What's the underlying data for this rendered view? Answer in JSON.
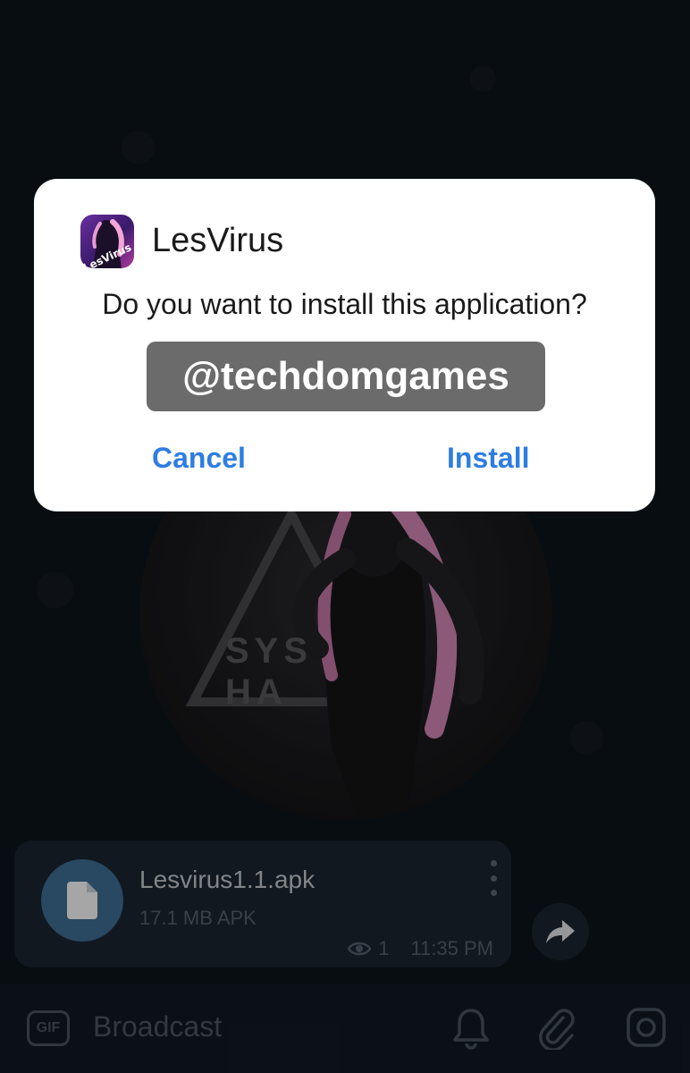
{
  "dialog": {
    "app_name": "LesVirus",
    "icon_text": "LesVirus",
    "question": "Do you want to install this application?",
    "watermark": "@techdomgames",
    "cancel_label": "Cancel",
    "install_label": "Install"
  },
  "message": {
    "poster_line1": "SYS",
    "poster_line2": "HA",
    "file_name": "Lesvirus1.1.apk",
    "file_size": "17.1 MB APK",
    "views": "1",
    "time": "11:35 PM"
  },
  "bottom_bar": {
    "gif_label": "GIF",
    "broadcast_label": "Broadcast"
  },
  "colors": {
    "accent": "#2f7de1",
    "file_icon_bg": "#3f6f97",
    "background": "#0c141b"
  },
  "icons": [
    "file-icon",
    "more-vert-icon",
    "eye-icon",
    "share-arrow-icon",
    "bell-icon",
    "paperclip-icon",
    "camera-icon"
  ]
}
